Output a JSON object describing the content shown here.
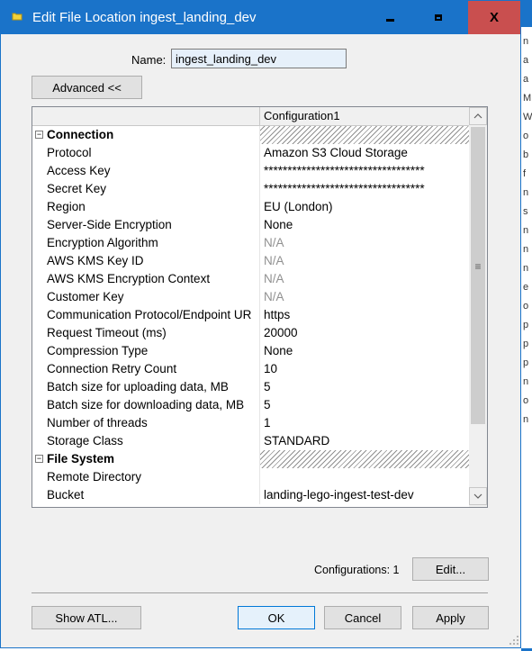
{
  "window": {
    "title": "Edit File Location ingest_landing_dev",
    "minimize_label": "—",
    "close_label": "X",
    "title_icon": "yellow-folder-icon",
    "accent_color": "#1a73c9",
    "close_color": "#c94f4f"
  },
  "name_field": {
    "label": "Name:",
    "value": "ingest_landing_dev"
  },
  "advanced_button": "Advanced <<",
  "grid": {
    "column_header": "Configuration1",
    "rows": [
      {
        "name": "Connection",
        "value": "",
        "section": true
      },
      {
        "name": "Protocol",
        "value": "Amazon S3 Cloud Storage"
      },
      {
        "name": "Access Key",
        "value": "**********************************"
      },
      {
        "name": "Secret Key",
        "value": "**********************************"
      },
      {
        "name": "Region",
        "value": "EU (London)"
      },
      {
        "name": "Server-Side Encryption",
        "value": "None"
      },
      {
        "name": "Encryption Algorithm",
        "value": "N/A",
        "disabled": true
      },
      {
        "name": "AWS KMS Key ID",
        "value": "N/A",
        "disabled": true
      },
      {
        "name": "AWS KMS Encryption Context",
        "value": "N/A",
        "disabled": true
      },
      {
        "name": "Customer Key",
        "value": "N/A",
        "disabled": true
      },
      {
        "name": "Communication Protocol/Endpoint UR",
        "value": "https"
      },
      {
        "name": "Request Timeout (ms)",
        "value": "20000"
      },
      {
        "name": "Compression Type",
        "value": "None"
      },
      {
        "name": "Connection Retry Count",
        "value": "10"
      },
      {
        "name": "Batch size for uploading data, MB",
        "value": "5"
      },
      {
        "name": "Batch size for downloading data, MB",
        "value": "5"
      },
      {
        "name": "Number of threads",
        "value": "1"
      },
      {
        "name": "Storage Class",
        "value": "STANDARD"
      },
      {
        "name": "File System",
        "value": "",
        "section": true
      },
      {
        "name": "Remote Directory",
        "value": ""
      },
      {
        "name": "Bucket",
        "value": "landing-lego-ingest-test-dev"
      }
    ],
    "expander_glyph": "−",
    "scroll_up_icon": "chevron-up-icon",
    "scroll_down_icon": "chevron-down-icon",
    "scroll_up_glyph": "⌃",
    "scroll_down_glyph": "⌄",
    "grip_glyph": "≡"
  },
  "configurations_label": "Configurations: 1",
  "edit_button": "Edit...",
  "show_atl_button": "Show ATL...",
  "ok_button": "OK",
  "cancel_button": "Cancel",
  "apply_button": "Apply",
  "background_window_glyphs": [
    "n",
    "a",
    "a",
    "M",
    "W",
    "o",
    "b",
    "f",
    "n",
    "s",
    "n",
    "n",
    "n",
    "e",
    "o",
    "p",
    "p",
    "p",
    "n",
    "o",
    "n"
  ]
}
